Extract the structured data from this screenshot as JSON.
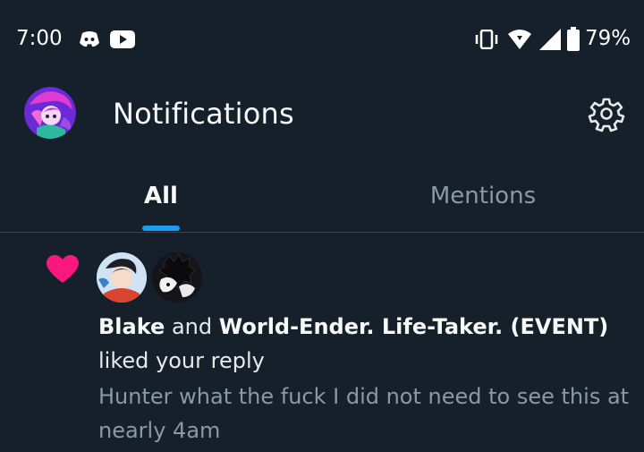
{
  "status_bar": {
    "time": "7:00",
    "battery": "79%",
    "icons": [
      "discord-icon",
      "youtube-icon",
      "vibrate-icon",
      "wifi-icon",
      "signal-icon",
      "battery-icon"
    ]
  },
  "header": {
    "title": "Notifications",
    "icons": [
      "avatar",
      "gear-icon"
    ]
  },
  "tabs": [
    {
      "label": "All",
      "active": true
    },
    {
      "label": "Mentions",
      "active": false
    }
  ],
  "notification": {
    "icon": "heart-icon",
    "user1": "Blake",
    "conjunction": "and",
    "user2": "World-Ender. Life-Taker. (EVENT)",
    "action": "liked your reply",
    "preview": "Hunter what the fuck I did not need to see this at nearly 4am"
  },
  "colors": {
    "background": "#15202b",
    "accent": "#1d9bf0",
    "like": "#f91880",
    "muted_text": "#8b98a5",
    "divider": "#38444d"
  }
}
